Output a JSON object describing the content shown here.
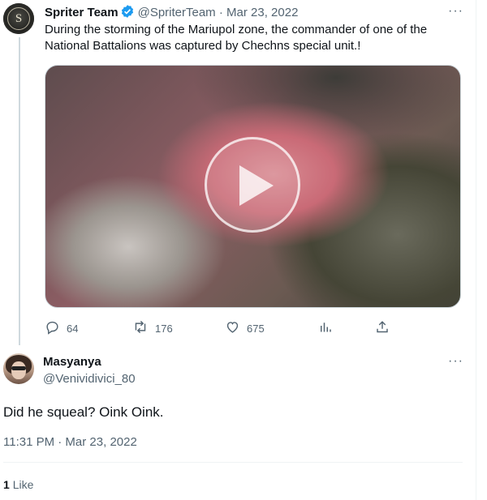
{
  "tweet": {
    "display_name": "Spriter Team",
    "handle": "@SpriterTeam",
    "separator": "·",
    "date": "Mar 23, 2022",
    "avatar_letter": "S",
    "text": "During the storming of the Mariupol zone, the commander of one of the National Battalions was captured by Chechns special unit.!",
    "media": {
      "type": "video"
    },
    "actions": {
      "reply_count": "64",
      "retweet_count": "176",
      "like_count": "675"
    }
  },
  "reply": {
    "display_name": "Masyanya",
    "handle": "@Venividivici_80",
    "text": "Did he squeal? Oink Oink.",
    "timestamp": "11:31 PM · Mar 23, 2022",
    "like_number": "1",
    "like_label": "Like"
  },
  "icons": {
    "more": "more-icon",
    "verified": "verified-badge-icon",
    "reply": "reply-icon",
    "retweet": "retweet-icon",
    "like": "like-icon",
    "views": "views-icon",
    "share": "share-icon",
    "play": "play-icon"
  },
  "colors": {
    "accent": "#1d9bf0",
    "text_primary": "#0f1419",
    "text_secondary": "#536471",
    "border": "#eff3f4"
  }
}
